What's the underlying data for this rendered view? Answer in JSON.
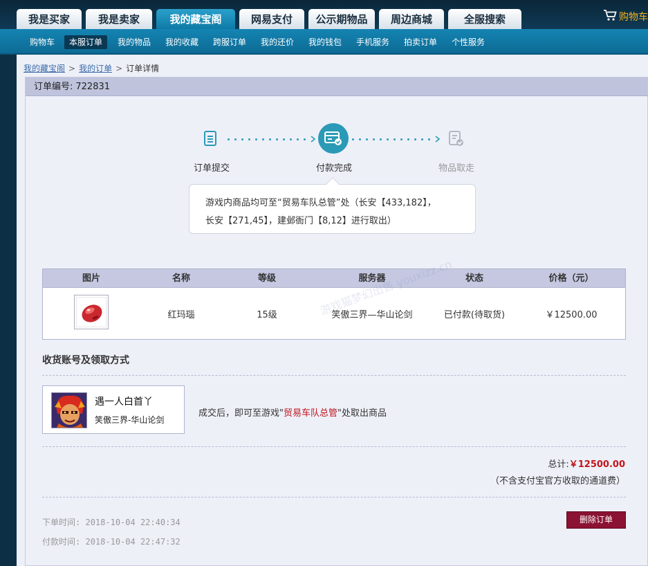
{
  "top_tabs": [
    {
      "label": "我是买家"
    },
    {
      "label": "我是卖家"
    },
    {
      "label": "我的藏宝阁"
    },
    {
      "label": "网易支付"
    },
    {
      "label": "公示期物品"
    },
    {
      "label": "周边商城"
    },
    {
      "label": "全服搜索"
    }
  ],
  "cart_label": "购物车",
  "sub_nav": [
    {
      "label": "购物车"
    },
    {
      "label": "本服订单"
    },
    {
      "label": "我的物品"
    },
    {
      "label": "我的收藏"
    },
    {
      "label": "跨服订单"
    },
    {
      "label": "我的还价"
    },
    {
      "label": "我的钱包"
    },
    {
      "label": "手机服务"
    },
    {
      "label": "拍卖订单"
    },
    {
      "label": "个性服务"
    }
  ],
  "breadcrumb": {
    "home": "我的藏宝阁",
    "orders": "我的订单",
    "current": "订单详情"
  },
  "order": {
    "number_label": "订单编号:",
    "number": "722831"
  },
  "steps": [
    {
      "label": "订单提交",
      "state": "done"
    },
    {
      "label": "付款完成",
      "state": "current"
    },
    {
      "label": "物品取走",
      "state": "pending"
    }
  ],
  "tip": {
    "line1": "游戏内商品均可至“贸易车队总管”处（长安【433,182】，",
    "line2": "长安【271,45】，建邺衙门【8,12】进行取出）"
  },
  "table": {
    "headers": [
      "图片",
      "名称",
      "等级",
      "服务器",
      "状态",
      "价格（元）"
    ],
    "row": {
      "name": "红玛瑙",
      "level": "15级",
      "server": "笑傲三界—华山论剑",
      "status": "已付款(待取货)",
      "price": "￥12500.00"
    }
  },
  "watermark": "游戏猫梦幻出售 youxizz.cn",
  "receive": {
    "title": "收货账号及领取方式",
    "account_name": "遇一人白首丫",
    "account_server": "笑傲三界-华山论剑",
    "pickup_prefix": "成交后，即可至游戏\"",
    "pickup_npc": "贸易车队总管",
    "pickup_suffix": "\"处取出商品"
  },
  "summary": {
    "total_label": "总计:",
    "total_value": "￥12500.00",
    "fee_note": "（不含支付宝官方收取的通道费）"
  },
  "times": {
    "order_time_label": "下单时间:",
    "order_time": "2018-10-04 22:40:34",
    "pay_time_label": "付款时间:",
    "pay_time": "2018-10-04 22:47:32"
  },
  "delete_button": "删除订单",
  "colors": {
    "accent": "#1484b2",
    "step_active": "#2b9ab6",
    "price_red": "#c0161c",
    "delete_btn": "#8b1233"
  }
}
